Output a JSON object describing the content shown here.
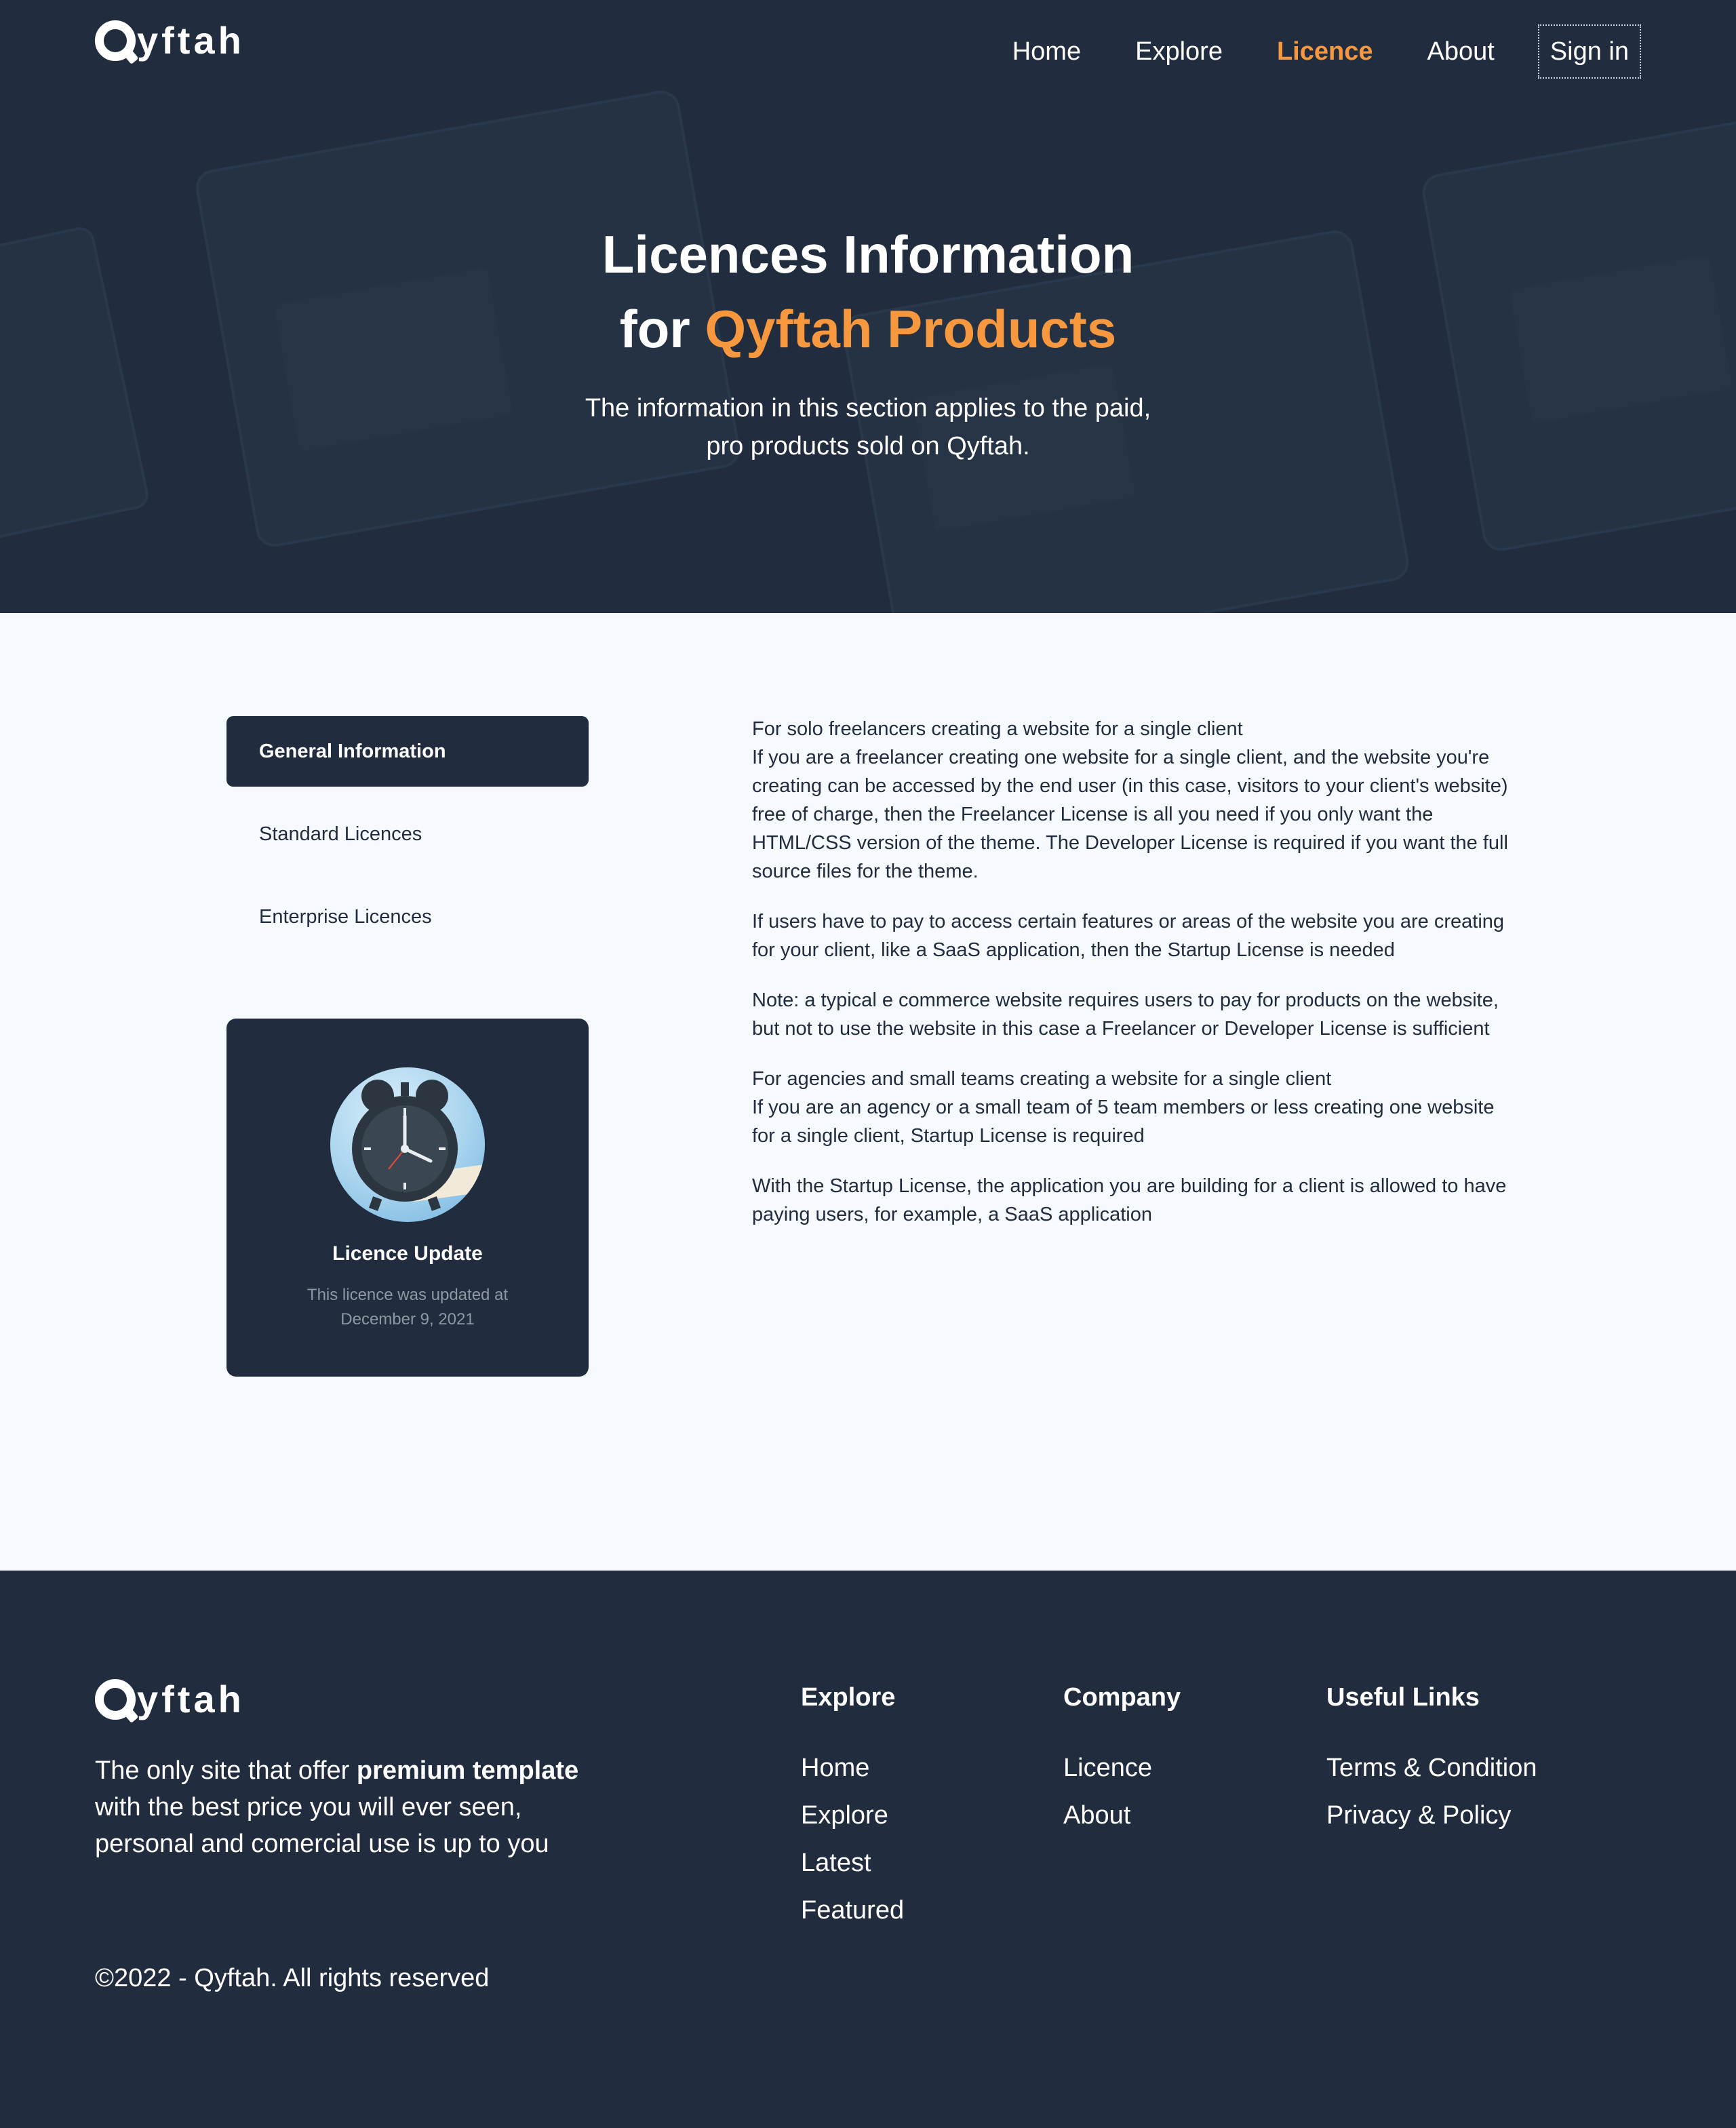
{
  "brand": {
    "name": "yftah"
  },
  "nav": {
    "items": [
      {
        "label": "Home"
      },
      {
        "label": "Explore"
      },
      {
        "label": "Licence"
      },
      {
        "label": "About"
      }
    ],
    "active": "Licence",
    "signin_label": "Sign in"
  },
  "hero": {
    "title_line1": "Licences Information",
    "title_line2_prefix": "for",
    "title_line2_accent": "Qyftah Products",
    "subtitle_line1": "The information in this section applies to the paid,",
    "subtitle_line2": "pro products sold on Qyftah."
  },
  "sidebar": {
    "tabs": [
      {
        "label": "General Information"
      },
      {
        "label": "Standard Licences"
      },
      {
        "label": "Enterprise Licences"
      }
    ],
    "active_tab": "General Information",
    "update_card": {
      "image_icon": "alarm-clock",
      "title": "Licence Update",
      "text_line1": "This licence was updated at",
      "text_line2": "December 9, 2021"
    }
  },
  "content": {
    "paragraphs": [
      "For solo freelancers creating a website for a single client\nIf you are a freelancer creating one website for a single client, and the website you're creating can be accessed by the end user (in this case, visitors to your client's website) free of charge, then the Freelancer License is all you need if you only want the HTML/CSS version of the theme. The Developer License is required if you want the full source files for the theme.",
      "If users have to pay to access certain features or areas of the website you are creating for your client, like a SaaS application, then the Startup License is needed",
      "Note: a typical e commerce website requires users to pay for products on the website, but not to use the website in this case a Freelancer or Developer License is sufficient",
      "For agencies and small teams creating a website for a single client\nIf you are an agency or a small team of 5 team members or less creating one website for a single client, Startup License is required",
      "With the Startup License, the application you are building for a client is allowed to have paying users, for example, a SaaS application"
    ]
  },
  "footer": {
    "desc_part1": "The only site that offer ",
    "desc_bold": "premium template",
    "desc_part2": " with the best price you will ever seen, personal and comercial use is up to you",
    "copyright": "©2022 - Qyftah. All rights reserved",
    "columns": [
      {
        "title": "Explore",
        "links": [
          "Home",
          "Explore",
          "Latest",
          "Featured"
        ]
      },
      {
        "title": "Company",
        "links": [
          "Licence",
          "About"
        ]
      },
      {
        "title": "Useful Links",
        "links": [
          "Terms & Condition",
          "Privacy & Policy"
        ]
      }
    ]
  },
  "colors": {
    "dark": "#212d3e",
    "accent": "#f7983e",
    "background": "#f6f9fd"
  }
}
